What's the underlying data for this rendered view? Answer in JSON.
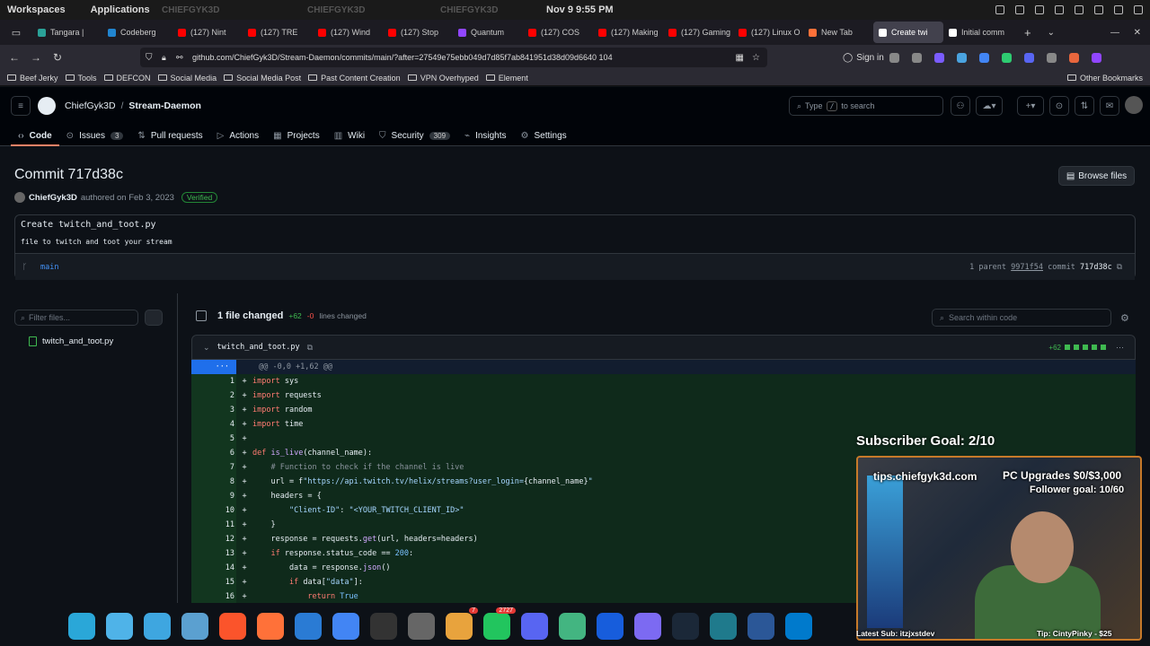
{
  "os": {
    "workspaces": "Workspaces",
    "applications": "Applications",
    "clock": "Nov 9  9:55 PM",
    "watermark": "CHIEFGYK3D"
  },
  "tabs": [
    {
      "label": "Tangara |",
      "color": "#2aa198"
    },
    {
      "label": "Codeberg",
      "color": "#2185d0"
    },
    {
      "label": "(127) Nint",
      "color": "#ff0000"
    },
    {
      "label": "(127) TRE",
      "color": "#ff0000"
    },
    {
      "label": "(127) Wind",
      "color": "#ff0000"
    },
    {
      "label": "(127) Stop",
      "color": "#ff0000"
    },
    {
      "label": "Quantum",
      "color": "#9146ff"
    },
    {
      "label": "(127) COS",
      "color": "#ff0000"
    },
    {
      "label": "(127) Making",
      "color": "#ff0000"
    },
    {
      "label": "(127) Gaming",
      "color": "#ff0000"
    },
    {
      "label": "(127) Linux O",
      "color": "#ff0000"
    },
    {
      "label": "New Tab",
      "color": "#ff7139"
    },
    {
      "label": "Create twi",
      "color": "#ffffff",
      "active": true
    },
    {
      "label": "Initial comm",
      "color": "#ffffff"
    }
  ],
  "browser": {
    "url": "github.com/ChiefGyk3D/Stream-Daemon/commits/main/?after=27549e75ebb049d7d85f7ab841951d38d09d6640 104",
    "signin": "Sign in"
  },
  "bookmarks": [
    "Beef Jerky",
    "Tools",
    "DEFCON",
    "Social Media",
    "Social Media Post",
    "Past Content Creation",
    "VPN Overhyped",
    "Element"
  ],
  "other_bookmarks": "Other Bookmarks",
  "gh": {
    "owner": "ChiefGyk3D",
    "separator": "/",
    "repo": "Stream-Daemon",
    "search_pre": "Type",
    "search_key": "/",
    "search_post": "to search",
    "nav": [
      {
        "label": "Code",
        "count": ""
      },
      {
        "label": "Issues",
        "count": "3"
      },
      {
        "label": "Pull requests",
        "count": ""
      },
      {
        "label": "Actions",
        "count": ""
      },
      {
        "label": "Projects",
        "count": ""
      },
      {
        "label": "Wiki",
        "count": ""
      },
      {
        "label": "Security",
        "count": "309"
      },
      {
        "label": "Insights",
        "count": ""
      },
      {
        "label": "Settings",
        "count": ""
      }
    ]
  },
  "commit": {
    "title": "Commit 717d38c",
    "browse": "Browse files",
    "author": "ChiefGyk3D",
    "authored_text": "authored on Feb 3, 2023",
    "verified": "Verified",
    "message": "Create twitch_and_toot.py",
    "body": "file to twitch and toot your stream",
    "branch": "main",
    "parent_label": "1 parent",
    "parent_sha": "9971f54",
    "commit_label": "commit",
    "commit_sha": "717d38c"
  },
  "diff": {
    "filter_placeholder": "Filter files...",
    "tree_file": "twitch_and_toot.py",
    "files_changed": "1 file changed",
    "additions": "+62",
    "deletions": "-0",
    "lines_changed": "lines changed",
    "search_placeholder": "Search within code",
    "file": "twitch_and_toot.py",
    "file_stat": "+62",
    "hunk": "@@ -0,0 +1,62 @@",
    "lines": [
      {
        "n": "1",
        "html": "<span class='kw'>import</span> sys"
      },
      {
        "n": "2",
        "html": "<span class='kw'>import</span> requests"
      },
      {
        "n": "3",
        "html": "<span class='kw'>import</span> random"
      },
      {
        "n": "4",
        "html": "<span class='kw'>import</span> time"
      },
      {
        "n": "5",
        "html": ""
      },
      {
        "n": "6",
        "html": "<span class='kw'>def</span> <span class='fn'>is_live</span>(channel_name):"
      },
      {
        "n": "7",
        "html": "    <span class='cm'># Function to check if the channel is live</span>"
      },
      {
        "n": "8",
        "html": "    url = f<span class='str'>\"https://api.twitch.tv/helix/streams?user_login=</span>{channel_name}<span class='str'>\"</span>"
      },
      {
        "n": "9",
        "html": "    headers = {"
      },
      {
        "n": "10",
        "html": "        <span class='str'>\"Client-ID\"</span>: <span class='str'>\"&lt;YOUR_TWITCH_CLIENT_ID&gt;\"</span>"
      },
      {
        "n": "11",
        "html": "    }"
      },
      {
        "n": "12",
        "html": "    response = requests.<span class='fn'>get</span>(url, headers=headers)"
      },
      {
        "n": "13",
        "html": "    <span class='kw'>if</span> response.status_code == <span class='nm'>200</span>:"
      },
      {
        "n": "14",
        "html": "        data = response.<span class='fn'>json</span>()"
      },
      {
        "n": "15",
        "html": "        <span class='kw'>if</span> data[<span class='str'>\"data\"</span>]:"
      },
      {
        "n": "16",
        "html": "            <span class='kw'>return</span> <span class='nm'>True</span>"
      }
    ]
  },
  "overlay": {
    "goal": "Subscriber Goal: 2/10",
    "tips": "tips.chiefgyk3d.com",
    "pc": "PC Upgrades $0/$3,000",
    "follower": "Follower goal: 10/60",
    "latest": "Latest Sub: itzjxstdev",
    "tip": "Tip: CintyPinky - $25"
  },
  "dock_colors": [
    "#2aa7d8",
    "#4fb3e8",
    "#3ea6e0",
    "#5ba0d0",
    "#fb542b",
    "#ff7139",
    "#2a7bd4",
    "#4285f4",
    "#333333",
    "#666666",
    "#e8a33d",
    "#22c55e",
    "#5865f2",
    "#43b581",
    "#175ddc",
    "#7c6af2",
    "#1b2838",
    "#1f7a8c",
    "#2b5797",
    "#007acc"
  ],
  "dock_badges": {
    "10": "7",
    "11": "2727"
  }
}
